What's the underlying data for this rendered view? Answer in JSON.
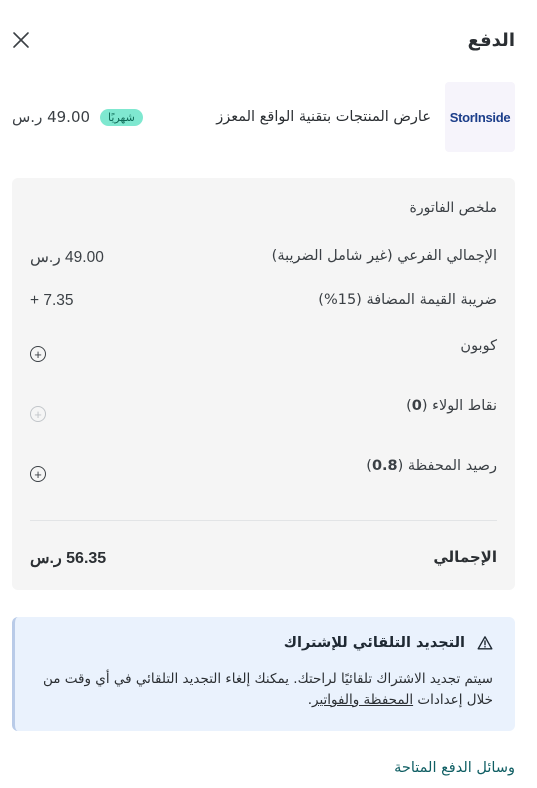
{
  "header": {
    "title": "الدفع",
    "close_icon": "close-icon"
  },
  "product": {
    "logo_text": "StorInside",
    "name": "عارض المنتجات بتقنية الواقع المعزز",
    "badge": "شهريًا",
    "price": "49.00 ر.س"
  },
  "summary": {
    "title": "ملخص الفاتورة",
    "subtotal": {
      "label": "الإجمالي الفرعي (غير شامل الضريبة)",
      "value": "49.00 ر.س"
    },
    "vat": {
      "label": "ضريبة القيمة المضافة (15%)",
      "value": "+ 7.35"
    },
    "coupon": {
      "label": "كوبون",
      "icon": "plus-circle-icon"
    },
    "loyalty": {
      "label_prefix": "نقاط الولاء (",
      "points": "0",
      "label_suffix": ")",
      "icon": "plus-circle-icon",
      "enabled": false
    },
    "wallet": {
      "label_prefix": "رصيد المحفظة (",
      "balance": "0.8",
      "label_suffix": ")",
      "icon": "plus-circle-icon"
    },
    "total": {
      "label": "الإجمالي",
      "value": "56.35 ر.س"
    }
  },
  "alert": {
    "icon": "warning-icon",
    "title": "التجديد التلقائي للإشتراك",
    "body": "سيتم تجديد الاشتراك تلقائيًا لراحتك. يمكنك إلغاء التجديد التلقائي في أي وقت من خلال إعدادات",
    "link": "المحفظة والفواتير",
    "end": "."
  },
  "payment_methods": {
    "title": "وسائل الدفع المتاحة"
  }
}
